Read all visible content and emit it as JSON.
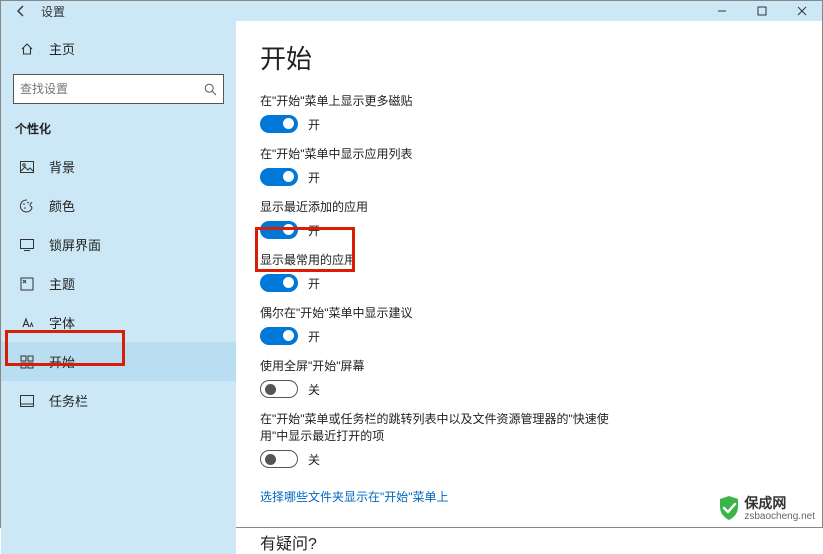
{
  "titlebar": {
    "title": "设置"
  },
  "sidebar": {
    "home": "主页",
    "search_placeholder": "查找设置",
    "section": "个性化",
    "items": [
      {
        "label": "背景"
      },
      {
        "label": "颜色"
      },
      {
        "label": "锁屏界面"
      },
      {
        "label": "主题"
      },
      {
        "label": "字体"
      },
      {
        "label": "开始"
      },
      {
        "label": "任务栏"
      }
    ]
  },
  "main": {
    "heading": "开始",
    "settings": [
      {
        "label": "在\"开始\"菜单上显示更多磁贴",
        "state": "开",
        "on": true
      },
      {
        "label": "在\"开始\"菜单中显示应用列表",
        "state": "开",
        "on": true
      },
      {
        "label": "显示最近添加的应用",
        "state": "开",
        "on": true
      },
      {
        "label": "显示最常用的应用",
        "state": "开",
        "on": true
      },
      {
        "label": "偶尔在\"开始\"菜单中显示建议",
        "state": "开",
        "on": true
      },
      {
        "label": "使用全屏\"开始\"屏幕",
        "state": "关",
        "on": false
      },
      {
        "label": "在\"开始\"菜单或任务栏的跳转列表中以及文件资源管理器的\"快速使用\"中显示最近打开的项",
        "state": "关",
        "on": false
      }
    ],
    "link": "选择哪些文件夹显示在\"开始\"菜单上",
    "question": "有疑问?"
  },
  "watermark": {
    "brand": "保成网",
    "url": "zsbaocheng.net"
  }
}
